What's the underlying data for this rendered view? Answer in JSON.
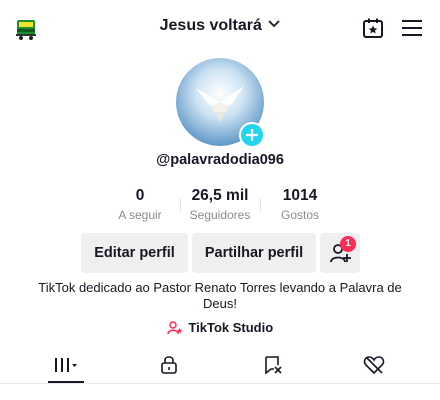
{
  "header": {
    "title": "Jesus voltará",
    "left_icon": "bus-icon",
    "calendar_icon": "calendar-star-icon",
    "menu_icon": "hamburger-menu-icon"
  },
  "profile": {
    "username": "@palavradodia096",
    "stats": [
      {
        "value": "0",
        "label": "A seguir"
      },
      {
        "value": "26,5 mil",
        "label": "Seguidores"
      },
      {
        "value": "1014",
        "label": "Gostos"
      }
    ],
    "edit_button": "Editar perfil",
    "share_button": "Partilhar perfil",
    "notification_count": "1",
    "bio": "TikTok dedicado ao Pastor Renato Torres levando a  Palavra de Deus!",
    "studio_link": "TikTok Studio"
  },
  "tabs": [
    {
      "name": "videos-grid",
      "icon": "grid-icon",
      "active": true
    },
    {
      "name": "private",
      "icon": "lock-icon",
      "active": false
    },
    {
      "name": "reposts",
      "icon": "repost-icon",
      "active": false
    },
    {
      "name": "liked",
      "icon": "heart-hidden-icon",
      "active": false
    }
  ],
  "colors": {
    "accent_cyan": "#20d5ec",
    "badge_red": "#fe2c55",
    "button_bg": "#efeff0",
    "text_dark": "#161823",
    "text_muted": "#8a8b91"
  }
}
